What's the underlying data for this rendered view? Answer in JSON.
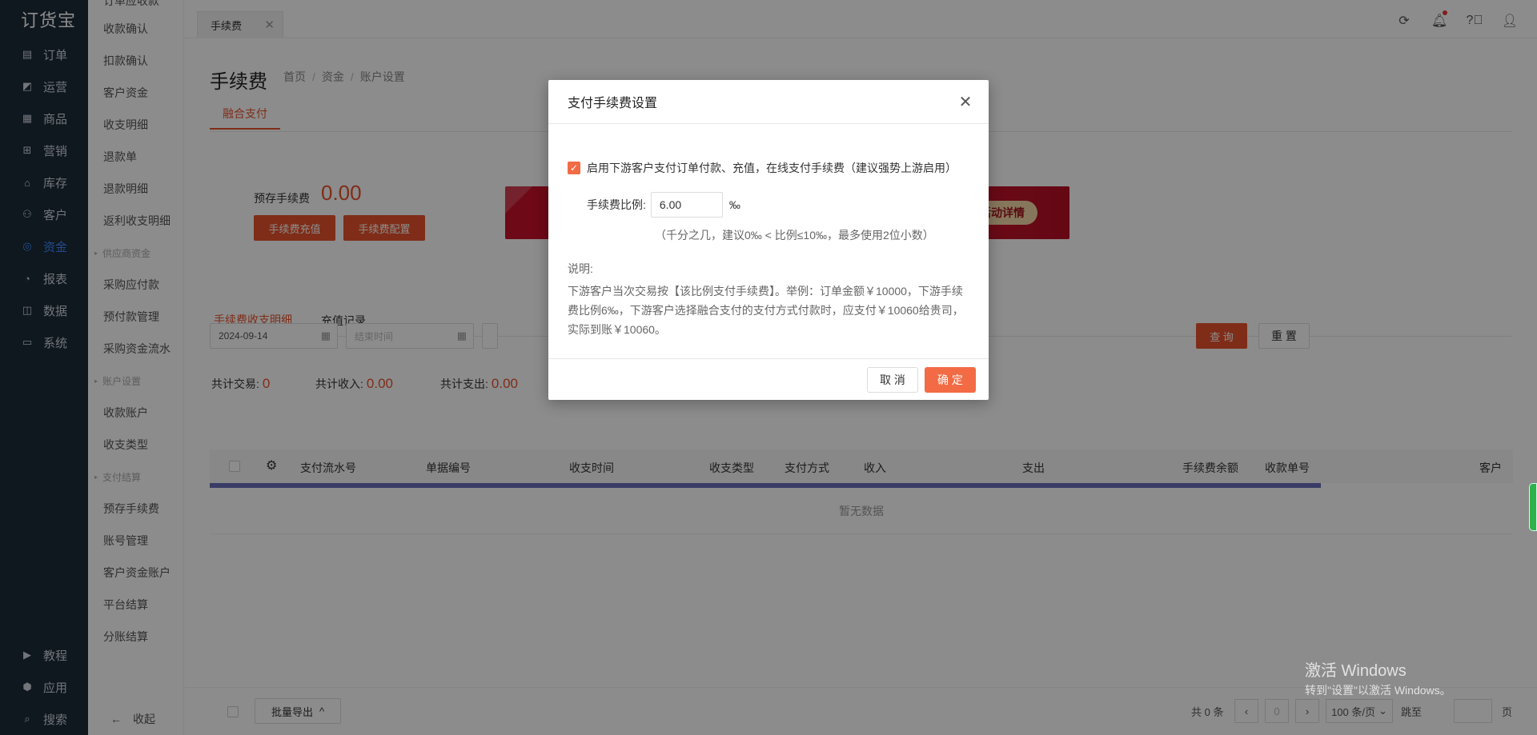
{
  "nav": {
    "logo": "订货宝",
    "items": [
      {
        "label": "订单",
        "icon": "order-icon"
      },
      {
        "label": "运营",
        "icon": "operations-icon"
      },
      {
        "label": "商品",
        "icon": "goods-icon"
      },
      {
        "label": "营销",
        "icon": "marketing-icon"
      },
      {
        "label": "库存",
        "icon": "inventory-icon"
      },
      {
        "label": "客户",
        "icon": "customer-icon"
      },
      {
        "label": "资金",
        "icon": "funds-icon",
        "active": true
      },
      {
        "label": "报表",
        "icon": "report-icon"
      },
      {
        "label": "数据",
        "icon": "data-icon"
      },
      {
        "label": "系统",
        "icon": "system-icon"
      }
    ],
    "bottom": [
      {
        "label": "教程",
        "icon": "tutorial-icon"
      },
      {
        "label": "应用",
        "icon": "apps-icon"
      },
      {
        "label": "搜索",
        "icon": "search-icon"
      }
    ]
  },
  "submenu": {
    "cut_item": "订单应收款",
    "items1": [
      "收款确认",
      "扣款确认",
      "客户资金",
      "收支明细",
      "退款单",
      "退款明细",
      "返利收支明细"
    ],
    "group1": "供应商资金",
    "items2": [
      "采购应付款",
      "预付款管理",
      "采购资金流水"
    ],
    "group2": "账户设置",
    "items3": [
      "收款账户",
      "收支类型"
    ],
    "group3": "支付结算",
    "items4": [
      "预存手续费",
      "账号管理",
      "客户资金账户",
      "平台结算",
      "分账结算"
    ],
    "collapse": "收起"
  },
  "topbar": {
    "tab": "手续费",
    "accent": "#e8532c"
  },
  "main": {
    "title": "手续费",
    "breadcrumb": [
      "首页",
      "资金",
      "账户设置"
    ],
    "top_tab": "融合支付",
    "fee_label": "预存手续费",
    "fee_amount": "0.00",
    "btn_recharge": "手续费充值",
    "btn_config": "手续费配置",
    "banner_button": "活动详情",
    "sec_tabs": [
      "手续费收支明细",
      "充值记录"
    ],
    "start_date": "2024-09-14",
    "end_placeholder": "结束时间",
    "btn_query": "查 询",
    "btn_reset": "重 置",
    "stats": {
      "trade_label": "共计交易:",
      "trade_value": "0",
      "income_label": "共计收入:",
      "income_value": "0.00",
      "expense_label": "共计支出:",
      "expense_value": "0.00"
    },
    "columns": [
      "支付流水号",
      "单据编号",
      "收支时间",
      "收支类型",
      "支付方式",
      "收入",
      "支出",
      "手续费余额",
      "收款单号",
      "客户"
    ],
    "empty": "暂无数据"
  },
  "footer": {
    "batch_export": "批量导出",
    "total": "共 0 条",
    "page": "0",
    "page_size": "100 条/页",
    "jump": "跳至",
    "page_unit": "页"
  },
  "modal": {
    "title": "支付手续费设置",
    "checkbox_label": "启用下游客户支付订单付款、充值，在线支付手续费（建议强势上游启用）",
    "rate_label": "手续费比例:",
    "rate_value": "6.00",
    "rate_unit": "‰",
    "hint": "（千分之几，建议0‰ < 比例≤10‰，最多使用2位小数）",
    "desc_title": "说明:",
    "desc": "下游客户当次交易按【该比例支付手续费】。举例：订单金额￥10000，下游手续费比例6‰，下游客户选择融合支付的支付方式付款时，应支付￥10060给贵司，实际到账￥10060。",
    "cancel": "取 消",
    "ok": "确 定"
  },
  "watermark": {
    "line1": "激活 Windows",
    "line2": "转到\"设置\"以激活 Windows。"
  }
}
